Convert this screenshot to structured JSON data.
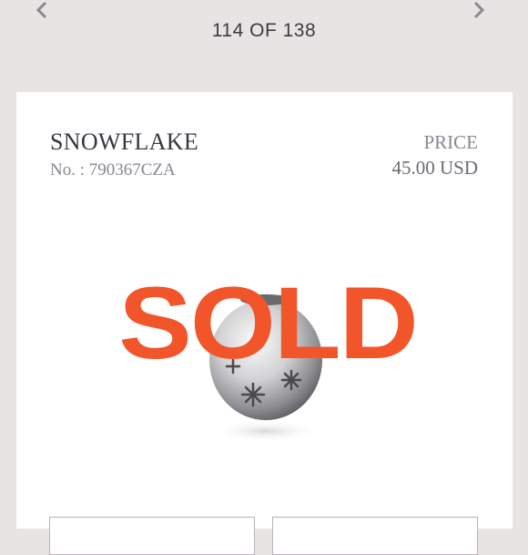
{
  "pager": {
    "text": "114 OF 138"
  },
  "product": {
    "name": "SNOWFLAKE",
    "number": "No. : 790367CZA",
    "price_label": "PRICE",
    "price_value": "45.00 USD"
  },
  "stamp": {
    "text": "SOLD",
    "color": "#f2552a"
  },
  "icons": {
    "prev": "chevron-left-icon",
    "next": "chevron-right-icon"
  }
}
